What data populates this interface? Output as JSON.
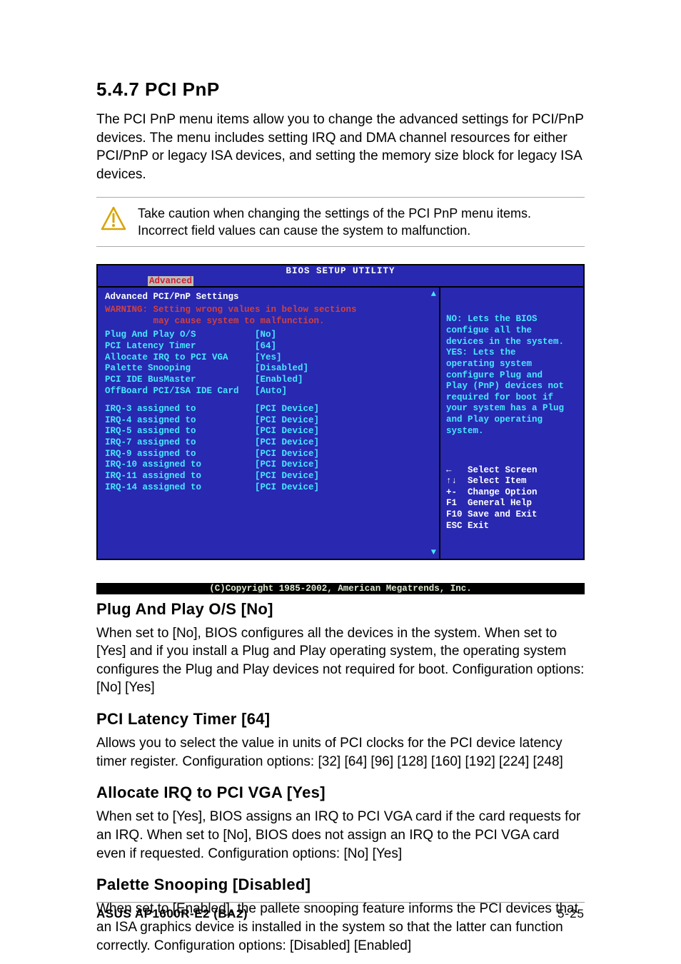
{
  "section": {
    "heading": "5.4.7  PCI PnP",
    "intro": "The PCI PnP menu items allow you to change the advanced settings for PCI/PnP devices. The menu includes setting IRQ and DMA channel resources for either PCI/PnP or legacy ISA devices, and setting the memory size block for legacy ISA devices.",
    "callout": "Take caution when changing the settings of the PCI PnP menu items. Incorrect field values can cause the system to malfunction."
  },
  "bios": {
    "title": "BIOS SETUP UTILITY",
    "tab": "Advanced",
    "left_heading": "Advanced PCI/PnP Settings",
    "warning_l1": "WARNING: Setting wrong values in below sections",
    "warning_l2": "         may cause system to malfunction.",
    "settings": [
      {
        "label": "Plug And Play O/S",
        "value": "[No]"
      },
      {
        "label": "PCI Latency Timer",
        "value": "[64]"
      },
      {
        "label": "Allocate IRQ to PCI VGA",
        "value": "[Yes]"
      },
      {
        "label": "Palette Snooping",
        "value": "[Disabled]"
      },
      {
        "label": "PCI IDE BusMaster",
        "value": "[Enabled]"
      },
      {
        "label": "OffBoard PCI/ISA IDE Card",
        "value": "[Auto]"
      }
    ],
    "irqs": [
      {
        "label": "IRQ-3 assigned to",
        "value": "[PCI Device]"
      },
      {
        "label": "IRQ-4 assigned to",
        "value": "[PCI Device]"
      },
      {
        "label": "IRQ-5 assigned to",
        "value": "[PCI Device]"
      },
      {
        "label": "IRQ-7 assigned to",
        "value": "[PCI Device]"
      },
      {
        "label": "IRQ-9 assigned to",
        "value": "[PCI Device]"
      },
      {
        "label": "IRQ-10 assigned to",
        "value": "[PCI Device]"
      },
      {
        "label": "IRQ-11 assigned to",
        "value": "[PCI Device]"
      },
      {
        "label": "IRQ-14 assigned to",
        "value": "[PCI Device]"
      }
    ],
    "right_help": "NO: Lets the BIOS\nconfigue all the\ndevices in the system.\nYES: Lets the\noperating system\nconfigure Plug and\nPlay (PnP) devices not\nrequired for boot if\nyour system has a Plug\nand Play operating\nsystem.",
    "right_nav": "←   Select Screen\n↑↓  Select Item\n+-  Change Option\nF1  General Help\nF10 Save and Exit\nESC Exit",
    "footer": "(C)Copyright 1985-2002, American Megatrends, Inc."
  },
  "subsections": [
    {
      "heading": "Plug And Play O/S [No]",
      "body": "When set to [No], BIOS configures all the devices in the system. When set to [Yes] and if you install a Plug and Play operating system, the operating system configures the Plug and Play devices not required for boot. Configuration options: [No] [Yes]"
    },
    {
      "heading": "PCI Latency Timer [64]",
      "body": "Allows you to select the value in units of PCI clocks for the PCI device latency timer register. Configuration options: [32] [64] [96] [128] [160] [192] [224] [248]"
    },
    {
      "heading": "Allocate IRQ to PCI VGA [Yes]",
      "body": "When set to [Yes], BIOS assigns an IRQ to PCI VGA card if the card requests for an IRQ. When set to [No], BIOS does not assign an IRQ to the PCI VGA card even if requested. Configuration options: [No] [Yes]"
    },
    {
      "heading": "Palette Snooping [Disabled]",
      "body": "When set to [Enabled], the pallete snooping feature informs the PCI devices that an ISA graphics device is installed in the system so that the latter can function correctly. Configuration options: [Disabled] [Enabled]"
    }
  ],
  "footer": {
    "left": "ASUS AP1600R-E2 (BA2)",
    "right": "5-25"
  }
}
